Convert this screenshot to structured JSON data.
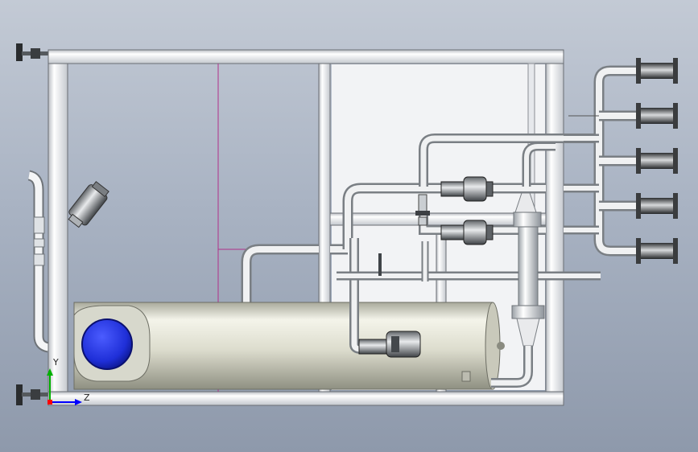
{
  "viewport": {
    "background_top": "#c3cad5",
    "background_bottom": "#8e99ab"
  },
  "triad": {
    "y_label": "Y",
    "z_label": "Z",
    "y_color": "#00b000",
    "z_color": "#0000ff",
    "x_color": "#ff0000"
  },
  "model": {
    "frame_color": "#eef0f4",
    "pipe_color": "#e4e6e8",
    "tank_color": "#dedfd4",
    "motor_cap_color": "#1f2fd8",
    "centerline_color": "#b0308a"
  }
}
